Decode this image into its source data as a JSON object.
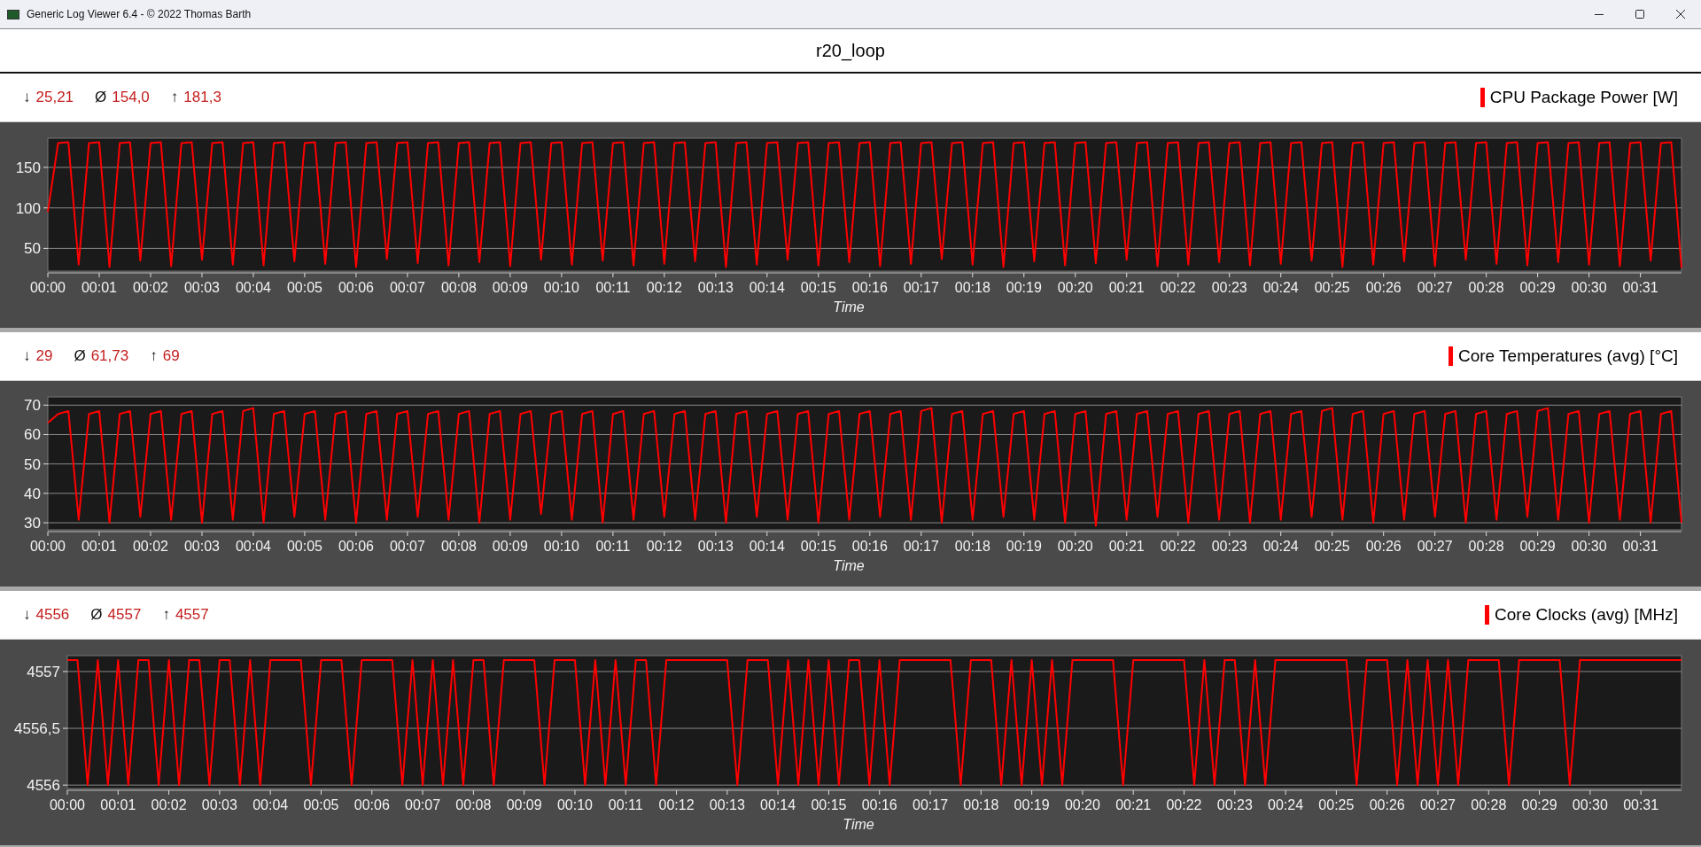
{
  "window": {
    "title": "Generic Log Viewer 6.4 - © 2022 Thomas Barth"
  },
  "header": {
    "title": "r20_loop"
  },
  "panels": [
    {
      "stats": [
        {
          "symbol": "↓",
          "value": "25,21"
        },
        {
          "symbol": "Ø",
          "value": "154,0"
        },
        {
          "symbol": "↑",
          "value": "181,3"
        }
      ],
      "chart_data": {
        "type": "line",
        "grid": true,
        "xlabel": "Time",
        "xlim": [
          0,
          31.8
        ],
        "ylim": [
          22,
          186
        ],
        "yticks": [
          50,
          100,
          150
        ],
        "xticks": [
          {
            "value": 0,
            "label": "00:00"
          },
          {
            "value": 1,
            "label": "00:01"
          },
          {
            "value": 2,
            "label": "00:02"
          },
          {
            "value": 3,
            "label": "00:03"
          },
          {
            "value": 4,
            "label": "00:04"
          },
          {
            "value": 5,
            "label": "00:05"
          },
          {
            "value": 6,
            "label": "00:06"
          },
          {
            "value": 7,
            "label": "00:07"
          },
          {
            "value": 8,
            "label": "00:08"
          },
          {
            "value": 9,
            "label": "00:09"
          },
          {
            "value": 10,
            "label": "00:10"
          },
          {
            "value": 11,
            "label": "00:11"
          },
          {
            "value": 12,
            "label": "00:12"
          },
          {
            "value": 13,
            "label": "00:13"
          },
          {
            "value": 14,
            "label": "00:14"
          },
          {
            "value": 15,
            "label": "00:15"
          },
          {
            "value": 16,
            "label": "00:16"
          },
          {
            "value": 17,
            "label": "00:17"
          },
          {
            "value": 18,
            "label": "00:18"
          },
          {
            "value": 19,
            "label": "00:19"
          },
          {
            "value": 20,
            "label": "00:20"
          },
          {
            "value": 21,
            "label": "00:21"
          },
          {
            "value": 22,
            "label": "00:22"
          },
          {
            "value": 23,
            "label": "00:23"
          },
          {
            "value": 24,
            "label": "00:24"
          },
          {
            "value": 25,
            "label": "00:25"
          },
          {
            "value": 26,
            "label": "00:26"
          },
          {
            "value": 27,
            "label": "00:27"
          },
          {
            "value": 28,
            "label": "00:28"
          },
          {
            "value": 29,
            "label": "00:29"
          },
          {
            "value": 30,
            "label": "00:30"
          },
          {
            "value": 31,
            "label": "00:31"
          }
        ],
        "x": [
          0,
          0.2,
          0.4,
          0.6,
          0.8,
          1,
          1.2,
          1.4,
          1.6,
          1.8,
          2,
          2.2,
          2.4,
          2.6,
          2.8,
          3,
          3.2,
          3.4,
          3.6,
          3.8,
          4,
          4.2,
          4.4,
          4.6,
          4.8,
          5,
          5.2,
          5.4,
          5.6,
          5.8,
          6,
          6.2,
          6.4,
          6.6,
          6.8,
          7,
          7.2,
          7.4,
          7.6,
          7.8,
          8,
          8.2,
          8.4,
          8.6,
          8.8,
          9,
          9.2,
          9.4,
          9.6,
          9.8,
          10,
          10.2,
          10.4,
          10.6,
          10.8,
          11,
          11.2,
          11.4,
          11.6,
          11.8,
          12,
          12.2,
          12.4,
          12.6,
          12.8,
          13,
          13.2,
          13.4,
          13.6,
          13.8,
          14,
          14.2,
          14.4,
          14.6,
          14.8,
          15,
          15.2,
          15.4,
          15.6,
          15.8,
          16,
          16.2,
          16.4,
          16.6,
          16.8,
          17,
          17.2,
          17.4,
          17.6,
          17.8,
          18,
          18.2,
          18.4,
          18.6,
          18.8,
          19,
          19.2,
          19.4,
          19.6,
          19.8,
          20,
          20.2,
          20.4,
          20.6,
          20.8,
          21,
          21.2,
          21.4,
          21.6,
          21.8,
          22,
          22.2,
          22.4,
          22.6,
          22.8,
          23,
          23.2,
          23.4,
          23.6,
          23.8,
          24,
          24.2,
          24.4,
          24.6,
          24.8,
          25,
          25.2,
          25.4,
          25.6,
          25.8,
          26,
          26.2,
          26.4,
          26.6,
          26.8,
          27,
          27.2,
          27.4,
          27.6,
          27.8,
          28,
          28.2,
          28.4,
          28.6,
          28.8,
          29,
          29.2,
          29.4,
          29.6,
          29.8,
          30,
          30.2,
          30.4,
          30.6,
          30.8,
          31,
          31.2,
          31.4,
          31.6,
          31.8
        ],
        "series": [
          {
            "name": "CPU Package Power [W]",
            "color": "#ff0000",
            "values": [
              95,
              180,
              181,
              30,
              180,
              181,
              27,
              180,
              181,
              35,
              180,
              181,
              28,
              180,
              181,
              36,
              180,
              181,
              30,
              180,
              181,
              29,
              180,
              181,
              34,
              180,
              181,
              31,
              180,
              181,
              27,
              180,
              181,
              37,
              180,
              181,
              32,
              180,
              181,
              29,
              180,
              181,
              33,
              180,
              181,
              28,
              180,
              181,
              36,
              180,
              181,
              30,
              180,
              181,
              35,
              180,
              181,
              29,
              180,
              181,
              31,
              180,
              181,
              34,
              180,
              181,
              27,
              180,
              181,
              30,
              180,
              181,
              36,
              180,
              181,
              29,
              180,
              181,
              33,
              180,
              181,
              28,
              180,
              181,
              31,
              180,
              181,
              37,
              180,
              181,
              30,
              180,
              181,
              27,
              180,
              181,
              34,
              180,
              181,
              29,
              180,
              181,
              32,
              180,
              181,
              36,
              180,
              181,
              28,
              180,
              181,
              30,
              180,
              181,
              33,
              180,
              181,
              29,
              180,
              181,
              31,
              180,
              181,
              35,
              180,
              181,
              27,
              180,
              181,
              30,
              180,
              181,
              34,
              180,
              181,
              28,
              180,
              181,
              36,
              180,
              181,
              31,
              180,
              181,
              29,
              180,
              181,
              33,
              180,
              181,
              30,
              180,
              181,
              28,
              180,
              181,
              35,
              180,
              181,
              26
            ]
          }
        ]
      }
    },
    {
      "stats": [
        {
          "symbol": "↓",
          "value": "29"
        },
        {
          "symbol": "Ø",
          "value": "61,73"
        },
        {
          "symbol": "↑",
          "value": "69"
        }
      ],
      "chart_data": {
        "type": "line",
        "grid": true,
        "xlabel": "Time",
        "xlim": [
          0,
          31.8
        ],
        "ylim": [
          27.6,
          72.8
        ],
        "yticks": [
          30,
          40,
          50,
          60,
          70
        ],
        "xticks": [
          {
            "value": 0,
            "label": "00:00"
          },
          {
            "value": 1,
            "label": "00:01"
          },
          {
            "value": 2,
            "label": "00:02"
          },
          {
            "value": 3,
            "label": "00:03"
          },
          {
            "value": 4,
            "label": "00:04"
          },
          {
            "value": 5,
            "label": "00:05"
          },
          {
            "value": 6,
            "label": "00:06"
          },
          {
            "value": 7,
            "label": "00:07"
          },
          {
            "value": 8,
            "label": "00:08"
          },
          {
            "value": 9,
            "label": "00:09"
          },
          {
            "value": 10,
            "label": "00:10"
          },
          {
            "value": 11,
            "label": "00:11"
          },
          {
            "value": 12,
            "label": "00:12"
          },
          {
            "value": 13,
            "label": "00:13"
          },
          {
            "value": 14,
            "label": "00:14"
          },
          {
            "value": 15,
            "label": "00:15"
          },
          {
            "value": 16,
            "label": "00:16"
          },
          {
            "value": 17,
            "label": "00:17"
          },
          {
            "value": 18,
            "label": "00:18"
          },
          {
            "value": 19,
            "label": "00:19"
          },
          {
            "value": 20,
            "label": "00:20"
          },
          {
            "value": 21,
            "label": "00:21"
          },
          {
            "value": 22,
            "label": "00:22"
          },
          {
            "value": 23,
            "label": "00:23"
          },
          {
            "value": 24,
            "label": "00:24"
          },
          {
            "value": 25,
            "label": "00:25"
          },
          {
            "value": 26,
            "label": "00:26"
          },
          {
            "value": 27,
            "label": "00:27"
          },
          {
            "value": 28,
            "label": "00:28"
          },
          {
            "value": 29,
            "label": "00:29"
          },
          {
            "value": 30,
            "label": "00:30"
          },
          {
            "value": 31,
            "label": "00:31"
          }
        ],
        "x": [
          0,
          0.2,
          0.4,
          0.6,
          0.8,
          1,
          1.2,
          1.4,
          1.6,
          1.8,
          2,
          2.2,
          2.4,
          2.6,
          2.8,
          3,
          3.2,
          3.4,
          3.6,
          3.8,
          4,
          4.2,
          4.4,
          4.6,
          4.8,
          5,
          5.2,
          5.4,
          5.6,
          5.8,
          6,
          6.2,
          6.4,
          6.6,
          6.8,
          7,
          7.2,
          7.4,
          7.6,
          7.8,
          8,
          8.2,
          8.4,
          8.6,
          8.8,
          9,
          9.2,
          9.4,
          9.6,
          9.8,
          10,
          10.2,
          10.4,
          10.6,
          10.8,
          11,
          11.2,
          11.4,
          11.6,
          11.8,
          12,
          12.2,
          12.4,
          12.6,
          12.8,
          13,
          13.2,
          13.4,
          13.6,
          13.8,
          14,
          14.2,
          14.4,
          14.6,
          14.8,
          15,
          15.2,
          15.4,
          15.6,
          15.8,
          16,
          16.2,
          16.4,
          16.6,
          16.8,
          17,
          17.2,
          17.4,
          17.6,
          17.8,
          18,
          18.2,
          18.4,
          18.6,
          18.8,
          19,
          19.2,
          19.4,
          19.6,
          19.8,
          20,
          20.2,
          20.4,
          20.6,
          20.8,
          21,
          21.2,
          21.4,
          21.6,
          21.8,
          22,
          22.2,
          22.4,
          22.6,
          22.8,
          23,
          23.2,
          23.4,
          23.6,
          23.8,
          24,
          24.2,
          24.4,
          24.6,
          24.8,
          25,
          25.2,
          25.4,
          25.6,
          25.8,
          26,
          26.2,
          26.4,
          26.6,
          26.8,
          27,
          27.2,
          27.4,
          27.6,
          27.8,
          28,
          28.2,
          28.4,
          28.6,
          28.8,
          29,
          29.2,
          29.4,
          29.6,
          29.8,
          30,
          30.2,
          30.4,
          30.6,
          30.8,
          31,
          31.2,
          31.4,
          31.6,
          31.8
        ],
        "series": [
          {
            "name": "Core Temperatures (avg) [°C]",
            "color": "#ff0000",
            "values": [
              64,
              67,
              68,
              31,
              67,
              68,
              30,
              67,
              68,
              32,
              67,
              68,
              31,
              67,
              68,
              30,
              67,
              68,
              31,
              68,
              69,
              30,
              67,
              68,
              32,
              67,
              68,
              31,
              67,
              68,
              30,
              67,
              68,
              31,
              67,
              68,
              32,
              67,
              68,
              31,
              67,
              68,
              30,
              67,
              68,
              31,
              67,
              68,
              33,
              67,
              68,
              31,
              67,
              68,
              30,
              67,
              68,
              31,
              67,
              68,
              32,
              67,
              68,
              31,
              67,
              68,
              30,
              67,
              68,
              32,
              67,
              68,
              31,
              67,
              68,
              30,
              67,
              68,
              31,
              67,
              68,
              32,
              67,
              68,
              31,
              68,
              69,
              30,
              67,
              68,
              31,
              67,
              68,
              32,
              67,
              68,
              31,
              67,
              68,
              30,
              67,
              68,
              29,
              67,
              68,
              31,
              67,
              68,
              32,
              67,
              68,
              30,
              67,
              68,
              31,
              67,
              68,
              30,
              67,
              68,
              31,
              67,
              68,
              32,
              68,
              69,
              31,
              67,
              68,
              30,
              67,
              68,
              31,
              67,
              68,
              32,
              67,
              68,
              30,
              67,
              68,
              31,
              67,
              68,
              32,
              68,
              69,
              31,
              67,
              68,
              30,
              67,
              68,
              31,
              67,
              68,
              30,
              67,
              68,
              30
            ]
          }
        ]
      }
    },
    {
      "stats": [
        {
          "symbol": "↓",
          "value": "4556"
        },
        {
          "symbol": "Ø",
          "value": "4557"
        },
        {
          "symbol": "↑",
          "value": "4557"
        }
      ],
      "chart_data": {
        "type": "line",
        "grid": true,
        "xlabel": "Time",
        "xlim": [
          0,
          31.8
        ],
        "ylim": [
          4555.97,
          4557.14
        ],
        "yticks": [
          {
            "value": 4556,
            "label": "4556"
          },
          {
            "value": 4556.5,
            "label": "4556,5"
          },
          {
            "value": 4557,
            "label": "4557"
          }
        ],
        "xticks": [
          {
            "value": 0,
            "label": "00:00"
          },
          {
            "value": 1,
            "label": "00:01"
          },
          {
            "value": 2,
            "label": "00:02"
          },
          {
            "value": 3,
            "label": "00:03"
          },
          {
            "value": 4,
            "label": "00:04"
          },
          {
            "value": 5,
            "label": "00:05"
          },
          {
            "value": 6,
            "label": "00:06"
          },
          {
            "value": 7,
            "label": "00:07"
          },
          {
            "value": 8,
            "label": "00:08"
          },
          {
            "value": 9,
            "label": "00:09"
          },
          {
            "value": 10,
            "label": "00:10"
          },
          {
            "value": 11,
            "label": "00:11"
          },
          {
            "value": 12,
            "label": "00:12"
          },
          {
            "value": 13,
            "label": "00:13"
          },
          {
            "value": 14,
            "label": "00:14"
          },
          {
            "value": 15,
            "label": "00:15"
          },
          {
            "value": 16,
            "label": "00:16"
          },
          {
            "value": 17,
            "label": "00:17"
          },
          {
            "value": 18,
            "label": "00:18"
          },
          {
            "value": 19,
            "label": "00:19"
          },
          {
            "value": 20,
            "label": "00:20"
          },
          {
            "value": 21,
            "label": "00:21"
          },
          {
            "value": 22,
            "label": "00:22"
          },
          {
            "value": 23,
            "label": "00:23"
          },
          {
            "value": 24,
            "label": "00:24"
          },
          {
            "value": 25,
            "label": "00:25"
          },
          {
            "value": 26,
            "label": "00:26"
          },
          {
            "value": 27,
            "label": "00:27"
          },
          {
            "value": 28,
            "label": "00:28"
          },
          {
            "value": 29,
            "label": "00:29"
          },
          {
            "value": 30,
            "label": "00:30"
          },
          {
            "value": 31,
            "label": "00:31"
          }
        ],
        "x": [
          0,
          0.2,
          0.4,
          0.6,
          0.8,
          1,
          1.2,
          1.4,
          1.6,
          1.8,
          2,
          2.2,
          2.4,
          2.6,
          2.8,
          3,
          3.2,
          3.4,
          3.6,
          3.8,
          4,
          4.2,
          4.4,
          4.6,
          4.8,
          5,
          5.2,
          5.4,
          5.6,
          5.8,
          6,
          6.2,
          6.4,
          6.6,
          6.8,
          7,
          7.2,
          7.4,
          7.6,
          7.8,
          8,
          8.2,
          8.4,
          8.6,
          8.8,
          9,
          9.2,
          9.4,
          9.6,
          9.8,
          10,
          10.2,
          10.4,
          10.6,
          10.8,
          11,
          11.2,
          11.4,
          11.6,
          11.8,
          12,
          12.2,
          12.4,
          12.6,
          12.8,
          13,
          13.2,
          13.4,
          13.6,
          13.8,
          14,
          14.2,
          14.4,
          14.6,
          14.8,
          15,
          15.2,
          15.4,
          15.6,
          15.8,
          16,
          16.2,
          16.4,
          16.6,
          16.8,
          17,
          17.2,
          17.4,
          17.6,
          17.8,
          18,
          18.2,
          18.4,
          18.6,
          18.8,
          19,
          19.2,
          19.4,
          19.6,
          19.8,
          20,
          20.2,
          20.4,
          20.6,
          20.8,
          21,
          21.2,
          21.4,
          21.6,
          21.8,
          22,
          22.2,
          22.4,
          22.6,
          22.8,
          23,
          23.2,
          23.4,
          23.6,
          23.8,
          24,
          24.2,
          24.4,
          24.6,
          24.8,
          25,
          25.2,
          25.4,
          25.6,
          25.8,
          26,
          26.2,
          26.4,
          26.6,
          26.8,
          27,
          27.2,
          27.4,
          27.6,
          27.8,
          28,
          28.2,
          28.4,
          28.6,
          28.8,
          29,
          29.2,
          29.4,
          29.6,
          29.8,
          30,
          30.2,
          30.4,
          30.6,
          30.8,
          31,
          31.2,
          31.4,
          31.6,
          31.8
        ],
        "series": [
          {
            "name": "Core Clocks (avg) [MHz]",
            "color": "#ff0000",
            "values": [
              4557.1,
              4557.1,
              4556,
              4557.1,
              4556,
              4557.1,
              4556,
              4557.1,
              4557.1,
              4556,
              4557.1,
              4556,
              4557.1,
              4557.1,
              4556,
              4557.1,
              4557.1,
              4556,
              4557.1,
              4556,
              4557.1,
              4557.1,
              4557.1,
              4557.1,
              4556,
              4557.1,
              4557.1,
              4557.1,
              4556,
              4557.1,
              4557.1,
              4557.1,
              4557.1,
              4556,
              4557.1,
              4556,
              4557.1,
              4556,
              4557.1,
              4556,
              4557.1,
              4557.1,
              4556,
              4557.1,
              4557.1,
              4557.1,
              4557.1,
              4556,
              4557.1,
              4557.1,
              4557.1,
              4556,
              4557.1,
              4556,
              4557.1,
              4556,
              4557.1,
              4557.1,
              4556,
              4557.1,
              4557.1,
              4557.1,
              4557.1,
              4557.1,
              4557.1,
              4557.1,
              4556,
              4557.1,
              4557.1,
              4557.1,
              4556,
              4557.1,
              4556,
              4557.1,
              4556,
              4557.1,
              4556,
              4557.1,
              4557.1,
              4556,
              4557.1,
              4556,
              4557.1,
              4557.1,
              4557.1,
              4557.1,
              4557.1,
              4557.1,
              4556,
              4557.1,
              4557.1,
              4557.1,
              4556,
              4557.1,
              4556,
              4557.1,
              4556,
              4557.1,
              4556,
              4557.1,
              4557.1,
              4557.1,
              4557.1,
              4557.1,
              4556,
              4557.1,
              4557.1,
              4557.1,
              4557.1,
              4557.1,
              4557.1,
              4556,
              4557.1,
              4556,
              4557.1,
              4557.1,
              4556,
              4557.1,
              4556,
              4557.1,
              4557.1,
              4557.1,
              4557.1,
              4557.1,
              4557.1,
              4557.1,
              4557.1,
              4556,
              4557.1,
              4557.1,
              4557.1,
              4556,
              4557.1,
              4556,
              4557.1,
              4556,
              4557.1,
              4556,
              4557.1,
              4557.1,
              4557.1,
              4557.1,
              4556,
              4557.1,
              4557.1,
              4557.1,
              4557.1,
              4557.1,
              4556,
              4557.1,
              4557.1,
              4557.1,
              4557.1,
              4557.1,
              4557.1,
              4557.1,
              4557.1,
              4557.1,
              4557.1,
              4557.1
            ]
          }
        ]
      }
    }
  ]
}
